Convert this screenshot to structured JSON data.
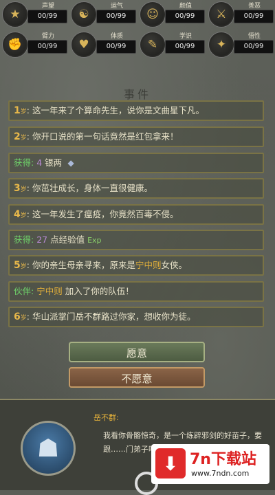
{
  "stats": [
    {
      "label": "声望",
      "value": "00/99",
      "icon": "reputation-icon",
      "glyph": "★"
    },
    {
      "label": "运气",
      "value": "00/99",
      "icon": "luck-icon",
      "glyph": "☯"
    },
    {
      "label": "颜值",
      "value": "00/99",
      "icon": "appearance-icon",
      "glyph": "☺"
    },
    {
      "label": "善恶",
      "value": "00/99",
      "icon": "morality-icon",
      "glyph": "⚔"
    },
    {
      "label": "臂力",
      "value": "00/99",
      "icon": "strength-icon",
      "glyph": "✊"
    },
    {
      "label": "体质",
      "value": "00/99",
      "icon": "constitution-icon",
      "glyph": "♥"
    },
    {
      "label": "学识",
      "value": "00/99",
      "icon": "knowledge-icon",
      "glyph": "✎"
    },
    {
      "label": "悟性",
      "value": "00/99",
      "icon": "comprehension-icon",
      "glyph": "✦"
    }
  ],
  "event_title": "事件",
  "rows": [
    {
      "age": "1",
      "unit": "岁",
      "text": "这一年来了个算命先生，说你是文曲星下凡。"
    },
    {
      "age": "2",
      "unit": "岁",
      "text": "你开口说的第一句话竟然是红包拿来！"
    },
    {
      "tag": "获得:",
      "num": "4",
      "text": "银两"
    },
    {
      "age": "3",
      "unit": "岁",
      "text": "你茁壮成长，身体一直很健康。"
    },
    {
      "age": "4",
      "unit": "岁",
      "text": "这一年发生了瘟疫，你竟然百毒不侵。"
    },
    {
      "tag": "获得:",
      "num": "27",
      "text": "点经验值",
      "exp": "Exp"
    },
    {
      "age": "5",
      "unit": "岁",
      "text": "你的亲生母亲寻来，原来是",
      "hl": "宁中则",
      "text2": "女侠。"
    },
    {
      "tag": "伙伴:",
      "hl": "宁中则",
      "text": "加入了你的队伍！"
    },
    {
      "age": "6",
      "unit": "岁",
      "text": "华山派掌门岳不群路过你家，想收你为徒。"
    }
  ],
  "buttons": {
    "accept": "愿意",
    "decline": "不愿意"
  },
  "dialogue": {
    "speaker": "岳不群:",
    "text": "我看你骨骼惊奇，是一个练辟邪剑的好苗子，要跟……门弟子吗？"
  },
  "watermark": {
    "title": "7n下载站",
    "url": "www.7ndn.com"
  }
}
